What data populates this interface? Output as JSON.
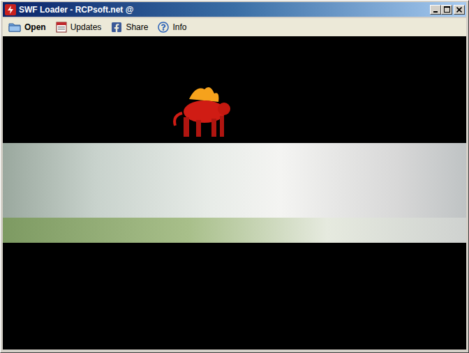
{
  "window": {
    "title": "SWF Loader - RCPsoft.net @"
  },
  "toolbar": {
    "buttons": [
      {
        "label": "Open",
        "icon": "folder",
        "emphasized": true
      },
      {
        "label": "Updates",
        "icon": "updates",
        "emphasized": false
      },
      {
        "label": "Share",
        "icon": "facebook",
        "emphasized": false
      },
      {
        "label": "Info",
        "icon": "help",
        "emphasized": false
      }
    ]
  },
  "stage": {
    "content": "flash-game-banner"
  }
}
